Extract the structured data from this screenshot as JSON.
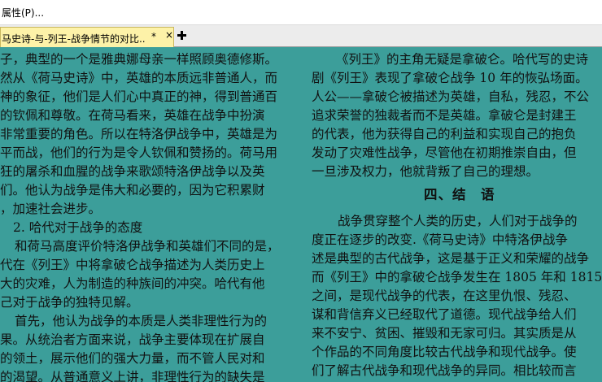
{
  "menu": {
    "properties": "属性(P)..."
  },
  "tabs": [
    {
      "title": "马史诗-与-列王-战争情节的对比..",
      "modified": "*"
    }
  ],
  "left_page": {
    "lines": [
      "子，典型的一个是雅典娜母亲一样照顾奥德修斯。",
      "然从《荷马史诗》中，英雄的本质远非普通人，而",
      "神的象征，他们是人们心中真正的神，得到普通百",
      "的钦佩和尊敬。在荷马看来，英雄在战争中扮演",
      "非常重要的角色。所以在特洛伊战争中，英雄是为",
      "平而战，他们的行为是令人钦佩和赞扬的。荷马用",
      "狂的屠杀和血腥的战争来歌颂特洛伊战争以及英",
      "们。他认为战争是伟大和必要的，因为它积累财",
      "，加速社会进步。",
      "2. 哈代对于战争的态度",
      "和荷马高度评价特洛伊战争和英雄们不同的是，",
      "代在《列王》中将拿破仑战争描述为人类历史上",
      "大的灾难，人为制造的种族间的冲突。哈代有他",
      "己对于战争的独特见解。",
      "首先，他认为战争的本质是人类非理性行为的",
      "果。从统治者方面来说，战争主要体现在扩展自",
      "的领土，展示他们的强大力量，而不管人民对和",
      "的渴望。从普通意义上讲，非理性行为的缺失是"
    ]
  },
  "right_page": {
    "lines": [
      "《列王》的主角无疑是拿破仑。哈代写的史诗",
      "剧《列王》表现了拿破仑战争 10 年的恢弘场面。",
      "人公——拿破仑被描述为英雄，自私，残忍，不公",
      "追求荣誉的独裁者而不是英雄。拿破仑是封建王",
      "的代表，他为获得自己的利益和实现自己的抱负",
      "发动了灾难性战争，尽管他在初期推崇自由，但",
      "一旦涉及权力，他就背叛了自己的理想。",
      "",
      "战争贯穿整个人类的历史，人们对于战争的",
      "度正在逐步的改变.《荷马史诗》中特洛伊战争",
      "述是典型的古代战争，这是基于正义和荣耀的战争",
      "而《列王》中的拿破仑战争发生在 1805 年和 1815",
      "之间，是现代战争的代表，在这里仇恨、残忍、",
      "谋和背信弃义已经取代了道德。现代战争给人们",
      "来不安宁、贫困、摧毁和无家可归。其实质是从",
      "个作品的不同角度比较古代战争和现代战争。使",
      "们了解古代战争和现代战争的异同。相比较而言"
    ],
    "heading": "四、结　语"
  }
}
